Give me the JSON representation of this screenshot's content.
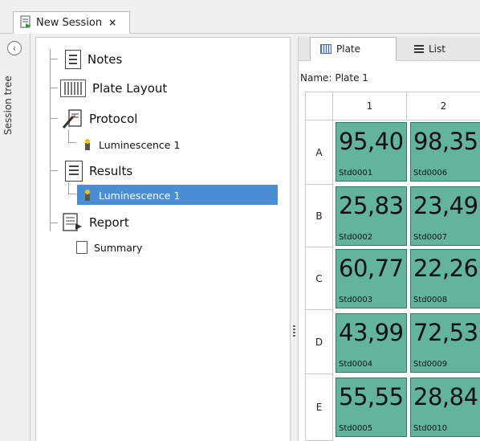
{
  "tab": {
    "title": "New Session",
    "close": "×"
  },
  "sidebar": {
    "label": "Session tree",
    "collapse_icon": "chevron-left-icon"
  },
  "tree": {
    "notes": "Notes",
    "plate_layout": "Plate Layout",
    "protocol": "Protocol",
    "protocol_child": "Luminescence 1",
    "results": "Results",
    "results_child": "Luminescence 1",
    "report": "Report",
    "report_child": "Summary"
  },
  "plate_view": {
    "tabs": [
      "Plate",
      "List"
    ],
    "name_label": "Name:",
    "name_value": "Plate 1",
    "columns": [
      "1",
      "2"
    ],
    "rows": [
      "A",
      "B",
      "C",
      "D",
      "E"
    ],
    "wells": [
      [
        {
          "value": "95,40",
          "id": "Std0001"
        },
        {
          "value": "98,35",
          "id": "Std0006"
        }
      ],
      [
        {
          "value": "25,83",
          "id": "Std0002"
        },
        {
          "value": "23,49",
          "id": "Std0007"
        }
      ],
      [
        {
          "value": "60,77",
          "id": "Std0003"
        },
        {
          "value": "22,26",
          "id": "Std0008"
        }
      ],
      [
        {
          "value": "43,99",
          "id": "Std0004"
        },
        {
          "value": "72,53",
          "id": "Std0009"
        }
      ],
      [
        {
          "value": "55,55",
          "id": "Std0005"
        },
        {
          "value": "28,84",
          "id": "Std0010"
        }
      ]
    ]
  },
  "colors": {
    "well_fill": "#62b49d",
    "selection": "#4a8fd4"
  }
}
